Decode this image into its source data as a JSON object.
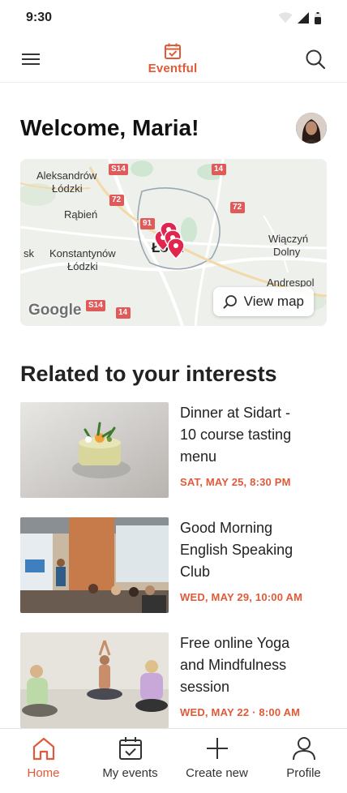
{
  "status_bar": {
    "time": "9:30"
  },
  "app_bar": {
    "brand": "Eventful"
  },
  "greeting": "Welcome, Maria!",
  "map": {
    "labels": {
      "aleksandrow": "Aleksandrów",
      "aleksandrow_line2": "Łódzki",
      "rabien": "Rąbień",
      "konstantynow": "Konstantynów",
      "konstantynow_line2": "Łódzki",
      "sk": "sk",
      "lodz": "Łódź",
      "wiaczyn": "Wiączyń",
      "wiaczyn_line2": "Dolny",
      "andrespol": "Andrespol"
    },
    "roads": {
      "s14_top": "S14",
      "r72_left": "72",
      "r14_top": "14",
      "r72_right": "72",
      "r91": "91",
      "s14_bottom": "S14",
      "r14_bottom": "14"
    },
    "google": "Google",
    "view_map_label": "View map"
  },
  "section_title": "Related to your interests",
  "events": [
    {
      "title_lines": [
        "Dinner at Sidart -",
        "10 course tasting",
        "menu"
      ],
      "date": "SAT, MAY 25, 8:30 PM"
    },
    {
      "title_lines": [
        "Good Morning",
        "English Speaking",
        "Club"
      ],
      "date": "WED, MAY 29, 10:00 AM"
    },
    {
      "title_lines": [
        "Free online Yoga",
        "and Mindfulness",
        "session"
      ],
      "date": "WED, MAY 22 · 8:00 AM"
    }
  ],
  "bottom_nav": [
    {
      "label": "Home"
    },
    {
      "label": "My events"
    },
    {
      "label": "Create new"
    },
    {
      "label": "Profile"
    }
  ],
  "colors": {
    "accent": "#e05a38",
    "pin": "#e0254f"
  }
}
